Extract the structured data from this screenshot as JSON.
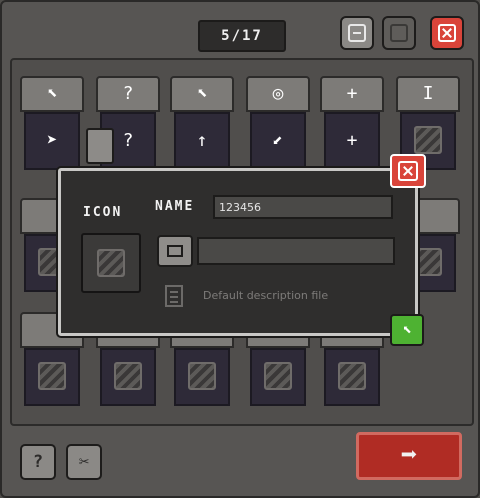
{
  "window": {
    "counter": "5/17",
    "colors": {
      "close": "#d9443a",
      "ok": "#4eb232",
      "action": "#b02c24"
    }
  },
  "slots": [
    {
      "top_glyph": "⬉",
      "bottom_glyph": "➤",
      "icon": "pointer-arrow-icon"
    },
    {
      "top_glyph": "?",
      "bottom_glyph": "?",
      "icon": "pointer-help-icon"
    },
    {
      "top_glyph": "⬉",
      "bottom_glyph": "↑",
      "icon": "pointer-busy-icon"
    },
    {
      "top_glyph": "◎",
      "bottom_glyph": "⬋",
      "icon": "target-icon"
    },
    {
      "top_glyph": "+",
      "bottom_glyph": "+",
      "icon": "crosshair-icon"
    },
    {
      "top_glyph": "I",
      "bottom_glyph": "",
      "icon": "text-cursor-icon"
    }
  ],
  "dialog": {
    "icon_label": "ICON",
    "name_label": "NAME",
    "name_value": "123456",
    "description_placeholder": "Default description file"
  },
  "bottom": {
    "help_glyph": "?",
    "tools_glyph": "✂",
    "action_glyph": "➡"
  }
}
